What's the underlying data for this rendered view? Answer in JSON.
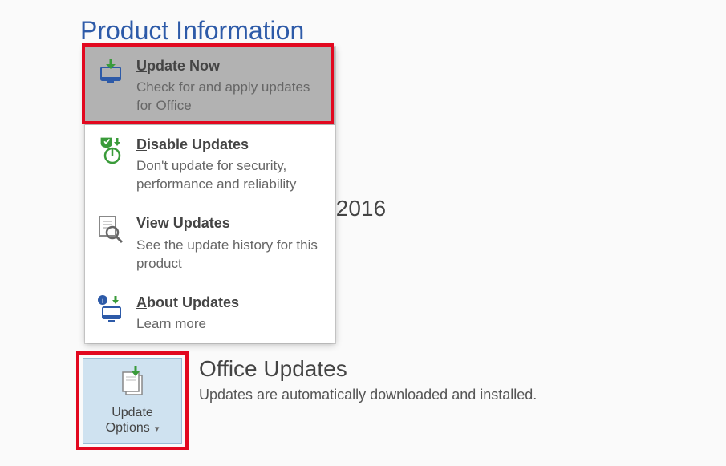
{
  "page": {
    "title": "Product Information",
    "background_text_suffix": "s 2016"
  },
  "menu": {
    "items": [
      {
        "title_u": "U",
        "title_rest": "pdate Now",
        "desc": "Check for and apply updates for Office"
      },
      {
        "title_u": "D",
        "title_rest": "isable Updates",
        "desc": "Don't update for security, performance and reliability"
      },
      {
        "title_u": "V",
        "title_rest": "iew Updates",
        "desc": "See the update history for this product"
      },
      {
        "title_u": "A",
        "title_rest": "bout Updates",
        "desc": "Learn more"
      }
    ]
  },
  "update_options": {
    "label_line1": "Update",
    "label_line2": "Options"
  },
  "office_updates": {
    "title": "Office Updates",
    "subtitle": "Updates are automatically downloaded and installed."
  }
}
